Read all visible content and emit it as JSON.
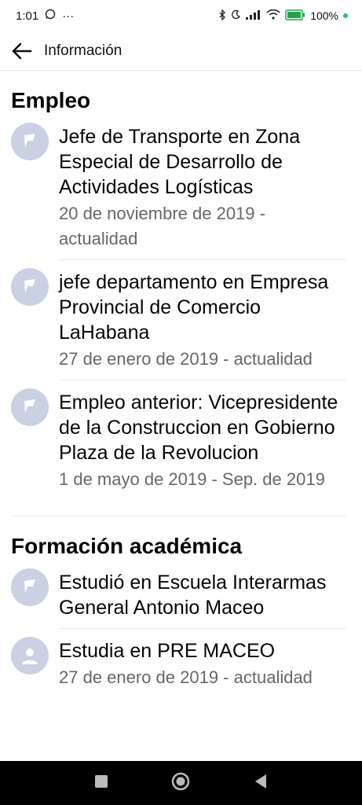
{
  "status_bar": {
    "time": "1:01",
    "more": "···",
    "battery": "100%"
  },
  "header": {
    "title": "Información"
  },
  "employment": {
    "heading": "Empleo",
    "items": [
      {
        "title": "Jefe de Transporte en Zona Especial de Desarrollo de Actividades Logísticas",
        "date": "20 de noviembre de 2019 - actualidad"
      },
      {
        "title": "jefe departamento en Empresa Provincial de Comercio LaHabana",
        "date": "27 de enero de 2019 - actualidad"
      },
      {
        "title": "Empleo anterior: Vicepresidente de la Construccion en Gobierno Plaza de la Revolucion",
        "date": "1 de mayo de 2019 - Sep. de 2019"
      }
    ]
  },
  "education": {
    "heading": "Formación académica",
    "items": [
      {
        "title": "Estudió en Escuela Interarmas General Antonio Maceo"
      },
      {
        "title": "Estudia en PRE MACEO",
        "date": "27 de enero de 2019 - actualidad"
      }
    ]
  },
  "icons": {
    "employment": "flag-icon",
    "education_1": "flag-icon",
    "education_2": "graduation-icon"
  }
}
